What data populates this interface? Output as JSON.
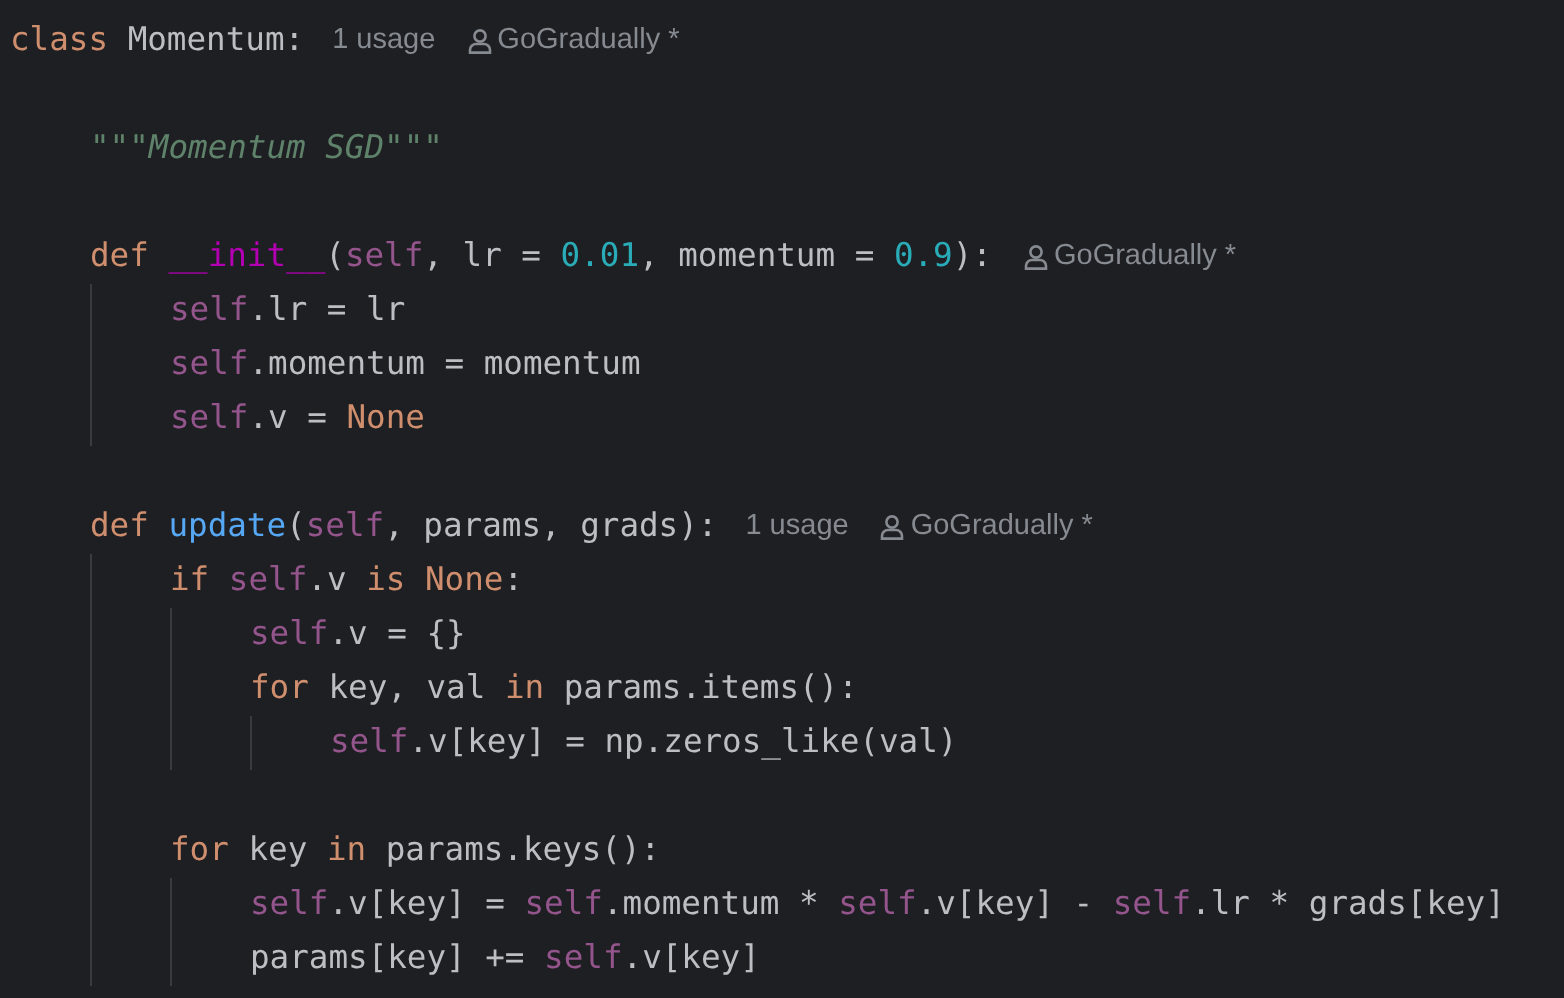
{
  "editor": {
    "lines": [
      {
        "kind": "code",
        "tokens": [
          {
            "text": "class ",
            "kind": "keyword"
          },
          {
            "text": "Momentum:",
            "kind": "plain"
          }
        ],
        "hints": [
          {
            "kind": "usage",
            "text": "1 usage"
          },
          {
            "kind": "author",
            "text": "GoGradually *"
          }
        ],
        "children": [
          {
            "kind": "blank"
          },
          {
            "kind": "code",
            "tokens": [
              {
                "text": "\"\"\"Momentum SGD\"\"\"",
                "kind": "docstring"
              }
            ]
          },
          {
            "kind": "blank"
          },
          {
            "kind": "code",
            "tokens": [
              {
                "text": "def ",
                "kind": "keyword"
              },
              {
                "text": "__init__",
                "kind": "dunder"
              },
              {
                "text": "(",
                "kind": "plain"
              },
              {
                "text": "self",
                "kind": "self"
              },
              {
                "text": ", lr = ",
                "kind": "plain"
              },
              {
                "text": "0.01",
                "kind": "number"
              },
              {
                "text": ", momentum = ",
                "kind": "plain"
              },
              {
                "text": "0.9",
                "kind": "number"
              },
              {
                "text": "):",
                "kind": "plain"
              }
            ],
            "hints": [
              {
                "kind": "author",
                "text": "GoGradually *"
              }
            ],
            "children": [
              {
                "kind": "code",
                "tokens": [
                  {
                    "text": "self",
                    "kind": "self"
                  },
                  {
                    "text": ".lr = lr",
                    "kind": "plain"
                  }
                ]
              },
              {
                "kind": "code",
                "tokens": [
                  {
                    "text": "self",
                    "kind": "self"
                  },
                  {
                    "text": ".momentum = momentum",
                    "kind": "plain"
                  }
                ]
              },
              {
                "kind": "code",
                "tokens": [
                  {
                    "text": "self",
                    "kind": "self"
                  },
                  {
                    "text": ".v = ",
                    "kind": "plain"
                  },
                  {
                    "text": "None",
                    "kind": "keyword"
                  }
                ]
              }
            ]
          },
          {
            "kind": "blank"
          },
          {
            "kind": "code",
            "tokens": [
              {
                "text": "def ",
                "kind": "keyword"
              },
              {
                "text": "update",
                "kind": "function"
              },
              {
                "text": "(",
                "kind": "plain"
              },
              {
                "text": "self",
                "kind": "self"
              },
              {
                "text": ", params, grads):",
                "kind": "plain"
              }
            ],
            "hints": [
              {
                "kind": "usage",
                "text": "1 usage"
              },
              {
                "kind": "author",
                "text": "GoGradually *"
              }
            ],
            "children": [
              {
                "kind": "code",
                "tokens": [
                  {
                    "text": "if ",
                    "kind": "keyword"
                  },
                  {
                    "text": "self",
                    "kind": "self"
                  },
                  {
                    "text": ".v ",
                    "kind": "plain"
                  },
                  {
                    "text": "is None",
                    "kind": "keyword"
                  },
                  {
                    "text": ":",
                    "kind": "plain"
                  }
                ],
                "children": [
                  {
                    "kind": "code",
                    "tokens": [
                      {
                        "text": "self",
                        "kind": "self"
                      },
                      {
                        "text": ".v = {}",
                        "kind": "plain"
                      }
                    ]
                  },
                  {
                    "kind": "code",
                    "tokens": [
                      {
                        "text": "for ",
                        "kind": "keyword"
                      },
                      {
                        "text": "key, val ",
                        "kind": "plain"
                      },
                      {
                        "text": "in ",
                        "kind": "keyword"
                      },
                      {
                        "text": "params.items():",
                        "kind": "plain"
                      }
                    ],
                    "children": [
                      {
                        "kind": "code",
                        "tokens": [
                          {
                            "text": "self",
                            "kind": "self"
                          },
                          {
                            "text": ".v[key] = np.zeros_like(val)",
                            "kind": "plain"
                          }
                        ]
                      }
                    ]
                  }
                ]
              },
              {
                "kind": "blank"
              },
              {
                "kind": "code",
                "tokens": [
                  {
                    "text": "for ",
                    "kind": "keyword"
                  },
                  {
                    "text": "key ",
                    "kind": "plain"
                  },
                  {
                    "text": "in ",
                    "kind": "keyword"
                  },
                  {
                    "text": "params.keys():",
                    "kind": "plain"
                  }
                ],
                "children": [
                  {
                    "kind": "code",
                    "tokens": [
                      {
                        "text": "self",
                        "kind": "self"
                      },
                      {
                        "text": ".v[key] = ",
                        "kind": "plain"
                      },
                      {
                        "text": "self",
                        "kind": "self"
                      },
                      {
                        "text": ".momentum * ",
                        "kind": "plain"
                      },
                      {
                        "text": "self",
                        "kind": "self"
                      },
                      {
                        "text": ".v[key] - ",
                        "kind": "plain"
                      },
                      {
                        "text": "self",
                        "kind": "self"
                      },
                      {
                        "text": ".lr * grads[key]",
                        "kind": "plain"
                      }
                    ]
                  },
                  {
                    "kind": "code",
                    "tokens": [
                      {
                        "text": "params[key] += ",
                        "kind": "plain"
                      },
                      {
                        "text": "self",
                        "kind": "self"
                      },
                      {
                        "text": ".v[key]",
                        "kind": "plain"
                      }
                    ]
                  }
                ]
              }
            ]
          }
        ]
      }
    ]
  }
}
